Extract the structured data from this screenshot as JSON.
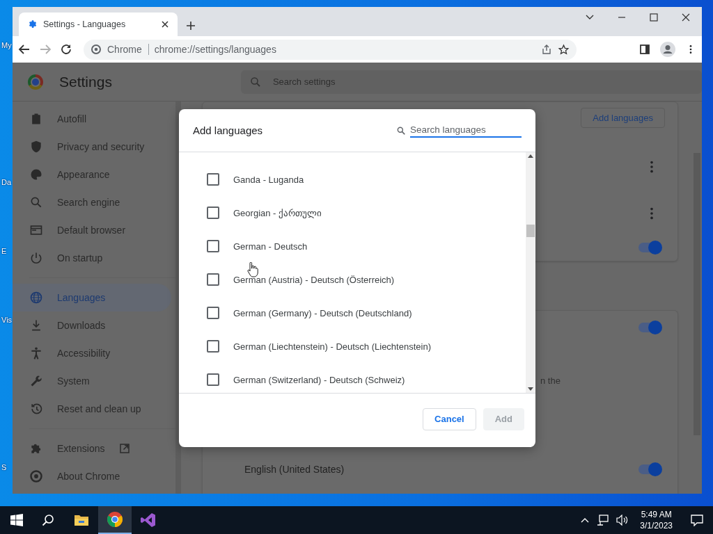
{
  "desktop": {
    "icons": [
      {
        "label": "My"
      },
      {
        "label": "Da"
      },
      {
        "label": "E"
      },
      {
        "label": "Vis"
      },
      {
        "label": "S"
      }
    ]
  },
  "browser": {
    "tabs": [
      {
        "title": "Settings - Languages",
        "selected": true
      }
    ],
    "address": {
      "site": "Chrome",
      "url": "chrome://settings/languages"
    }
  },
  "settings": {
    "title": "Settings",
    "search": {
      "placeholder": "Search settings"
    },
    "sidebar": {
      "sections": [
        {
          "items": [
            {
              "label": "Autofill",
              "selected": false
            },
            {
              "label": "Privacy and security",
              "selected": false
            },
            {
              "label": "Appearance",
              "selected": false
            },
            {
              "label": "Search engine",
              "selected": false
            },
            {
              "label": "Default browser",
              "selected": false
            },
            {
              "label": "On startup",
              "selected": false
            }
          ]
        },
        {
          "items": [
            {
              "label": "Languages",
              "selected": true
            },
            {
              "label": "Downloads",
              "selected": false
            },
            {
              "label": "Accessibility",
              "selected": false
            },
            {
              "label": "System",
              "selected": false
            },
            {
              "label": "Reset and clean up",
              "selected": false
            }
          ]
        },
        {
          "items": [
            {
              "label": "Extensions",
              "selected": false
            },
            {
              "label": "About Chrome",
              "selected": false
            }
          ]
        }
      ]
    },
    "main": {
      "add_button": "Add languages",
      "cards": [
        {
          "rows": [
            {
              "kind": "menu"
            },
            {
              "kind": "menu"
            },
            {
              "kind": "toggle",
              "on": true
            }
          ]
        },
        {
          "rows": [
            {
              "kind": "toggle",
              "on": true
            },
            {
              "kind": "text",
              "text": "n the"
            },
            {
              "kind": "toggle",
              "label": "English (United States)",
              "on": true
            }
          ]
        }
      ]
    }
  },
  "dialog": {
    "title": "Add languages",
    "search": {
      "placeholder": "Search languages"
    },
    "languages": [
      {
        "label": "Ganda - Luganda",
        "checked": false
      },
      {
        "label": "Georgian - ქართული",
        "checked": false
      },
      {
        "label": "German - Deutsch",
        "checked": false
      },
      {
        "label": "German (Austria) - Deutsch (Österreich)",
        "checked": false
      },
      {
        "label": "German (Germany) - Deutsch (Deutschland)",
        "checked": false
      },
      {
        "label": "German (Liechtenstein) - Deutsch (Liechtenstein)",
        "checked": false
      },
      {
        "label": "German (Switzerland) - Deutsch (Schweiz)",
        "checked": false
      }
    ],
    "buttons": [
      {
        "label": "Cancel",
        "disabled": false
      },
      {
        "label": "Add",
        "disabled": true
      }
    ]
  },
  "taskbar": {
    "apps": [
      {
        "selected": false
      },
      {
        "selected": true
      },
      {
        "selected": false
      }
    ],
    "clock": {
      "time": "5:49 AM",
      "date": "3/1/2023"
    }
  }
}
